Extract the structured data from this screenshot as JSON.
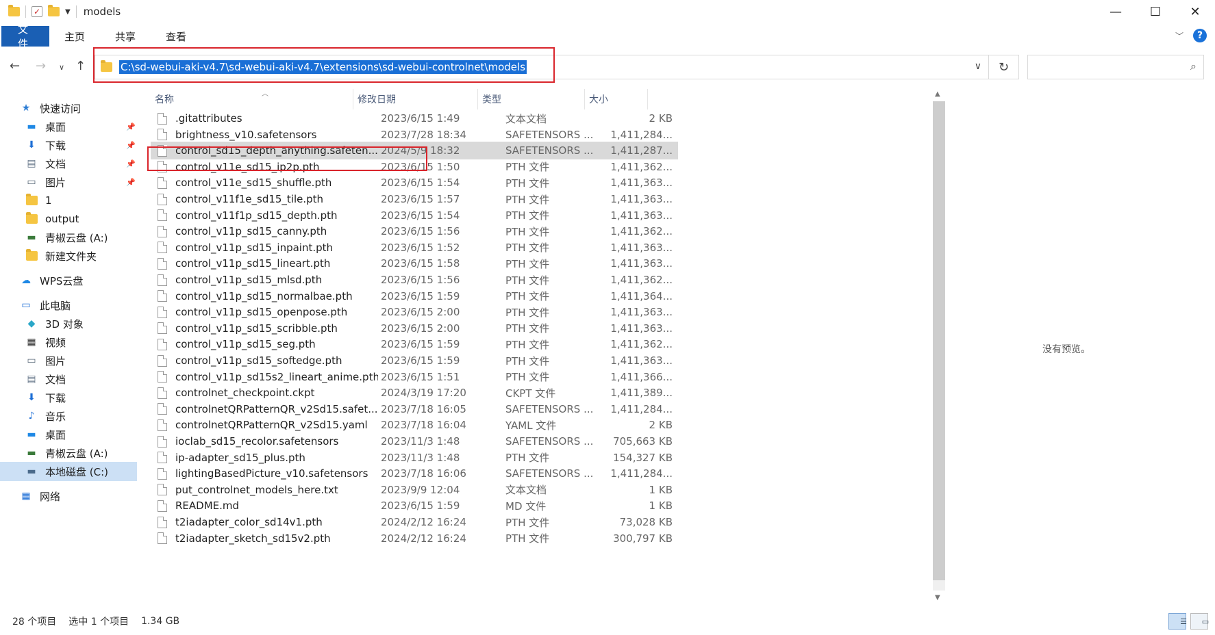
{
  "window": {
    "title": "models",
    "controls": {
      "minimize": "—",
      "maximize": "☐",
      "close": "✕"
    }
  },
  "ribbon": {
    "tabs": [
      "文件",
      "主页",
      "共享",
      "查看"
    ],
    "help": "?"
  },
  "address": {
    "path": "C:\\sd-webui-aki-v4.7\\sd-webui-aki-v4.7\\extensions\\sd-webui-controlnet\\models",
    "search_placeholder": ""
  },
  "sidebar": {
    "items": [
      {
        "label": "快速访问",
        "icon": "star-icon",
        "level": 0,
        "pinned": false
      },
      {
        "label": "桌面",
        "icon": "desktop-icon",
        "level": 1,
        "pinned": true
      },
      {
        "label": "下载",
        "icon": "download-icon",
        "level": 1,
        "pinned": true
      },
      {
        "label": "文档",
        "icon": "document-icon",
        "level": 1,
        "pinned": true
      },
      {
        "label": "图片",
        "icon": "pictures-icon",
        "level": 1,
        "pinned": true
      },
      {
        "label": "1",
        "icon": "folder-icon",
        "level": 1,
        "pinned": false
      },
      {
        "label": "output",
        "icon": "folder-icon",
        "level": 1,
        "pinned": false
      },
      {
        "label": "青椒云盘 (A:)",
        "icon": "network-drive-icon",
        "level": 1,
        "pinned": false
      },
      {
        "label": "新建文件夹",
        "icon": "folder-icon",
        "level": 1,
        "pinned": false
      },
      {
        "label": "WPS云盘",
        "icon": "cloud-icon",
        "level": 0,
        "pinned": false
      },
      {
        "label": "此电脑",
        "icon": "computer-icon",
        "level": 0,
        "pinned": false
      },
      {
        "label": "3D 对象",
        "icon": "3d-objects-icon",
        "level": 1,
        "pinned": false
      },
      {
        "label": "视频",
        "icon": "video-icon",
        "level": 1,
        "pinned": false
      },
      {
        "label": "图片",
        "icon": "pictures-icon",
        "level": 1,
        "pinned": false
      },
      {
        "label": "文档",
        "icon": "document-icon",
        "level": 1,
        "pinned": false
      },
      {
        "label": "下载",
        "icon": "download-icon",
        "level": 1,
        "pinned": false
      },
      {
        "label": "音乐",
        "icon": "music-icon",
        "level": 1,
        "pinned": false
      },
      {
        "label": "桌面",
        "icon": "desktop-icon",
        "level": 1,
        "pinned": false
      },
      {
        "label": "青椒云盘 (A:)",
        "icon": "network-drive-icon",
        "level": 1,
        "pinned": false
      },
      {
        "label": "本地磁盘 (C:)",
        "icon": "local-disk-icon",
        "level": 1,
        "pinned": false
      },
      {
        "label": "网络",
        "icon": "network-icon",
        "level": 0,
        "pinned": false
      }
    ],
    "selected_index": 19
  },
  "columns": [
    "名称",
    "修改日期",
    "类型",
    "大小"
  ],
  "files": [
    {
      "name": ".gitattributes",
      "date": "2023/6/15 1:49",
      "type": "文本文档",
      "size": "2 KB"
    },
    {
      "name": "brightness_v10.safetensors",
      "date": "2023/7/28 18:34",
      "type": "SAFETENSORS ...",
      "size": "1,411,284..."
    },
    {
      "name": "control_sd15_depth_anything.safeten...",
      "date": "2024/5/9 18:32",
      "type": "SAFETENSORS ...",
      "size": "1,411,287..."
    },
    {
      "name": "control_v11e_sd15_ip2p.pth",
      "date": "2023/6/15 1:50",
      "type": "PTH 文件",
      "size": "1,411,362..."
    },
    {
      "name": "control_v11e_sd15_shuffle.pth",
      "date": "2023/6/15 1:54",
      "type": "PTH 文件",
      "size": "1,411,363..."
    },
    {
      "name": "control_v11f1e_sd15_tile.pth",
      "date": "2023/6/15 1:57",
      "type": "PTH 文件",
      "size": "1,411,363..."
    },
    {
      "name": "control_v11f1p_sd15_depth.pth",
      "date": "2023/6/15 1:54",
      "type": "PTH 文件",
      "size": "1,411,363..."
    },
    {
      "name": "control_v11p_sd15_canny.pth",
      "date": "2023/6/15 1:56",
      "type": "PTH 文件",
      "size": "1,411,362..."
    },
    {
      "name": "control_v11p_sd15_inpaint.pth",
      "date": "2023/6/15 1:52",
      "type": "PTH 文件",
      "size": "1,411,363..."
    },
    {
      "name": "control_v11p_sd15_lineart.pth",
      "date": "2023/6/15 1:58",
      "type": "PTH 文件",
      "size": "1,411,363..."
    },
    {
      "name": "control_v11p_sd15_mlsd.pth",
      "date": "2023/6/15 1:56",
      "type": "PTH 文件",
      "size": "1,411,362..."
    },
    {
      "name": "control_v11p_sd15_normalbae.pth",
      "date": "2023/6/15 1:59",
      "type": "PTH 文件",
      "size": "1,411,364..."
    },
    {
      "name": "control_v11p_sd15_openpose.pth",
      "date": "2023/6/15 2:00",
      "type": "PTH 文件",
      "size": "1,411,363..."
    },
    {
      "name": "control_v11p_sd15_scribble.pth",
      "date": "2023/6/15 2:00",
      "type": "PTH 文件",
      "size": "1,411,363..."
    },
    {
      "name": "control_v11p_sd15_seg.pth",
      "date": "2023/6/15 1:59",
      "type": "PTH 文件",
      "size": "1,411,362..."
    },
    {
      "name": "control_v11p_sd15_softedge.pth",
      "date": "2023/6/15 1:59",
      "type": "PTH 文件",
      "size": "1,411,363..."
    },
    {
      "name": "control_v11p_sd15s2_lineart_anime.pth",
      "date": "2023/6/15 1:51",
      "type": "PTH 文件",
      "size": "1,411,366..."
    },
    {
      "name": "controlnet_checkpoint.ckpt",
      "date": "2024/3/19 17:20",
      "type": "CKPT 文件",
      "size": "1,411,389..."
    },
    {
      "name": "controlnetQRPatternQR_v2Sd15.safet...",
      "date": "2023/7/18 16:05",
      "type": "SAFETENSORS ...",
      "size": "1,411,284..."
    },
    {
      "name": "controlnetQRPatternQR_v2Sd15.yaml",
      "date": "2023/7/18 16:04",
      "type": "YAML 文件",
      "size": "2 KB"
    },
    {
      "name": "ioclab_sd15_recolor.safetensors",
      "date": "2023/11/3 1:48",
      "type": "SAFETENSORS ...",
      "size": "705,663 KB"
    },
    {
      "name": "ip-adapter_sd15_plus.pth",
      "date": "2023/11/3 1:48",
      "type": "PTH 文件",
      "size": "154,327 KB"
    },
    {
      "name": "lightingBasedPicture_v10.safetensors",
      "date": "2023/7/18 16:06",
      "type": "SAFETENSORS ...",
      "size": "1,411,284..."
    },
    {
      "name": "put_controlnet_models_here.txt",
      "date": "2023/9/9 12:04",
      "type": "文本文档",
      "size": "1 KB"
    },
    {
      "name": "README.md",
      "date": "2023/6/15 1:59",
      "type": "MD 文件",
      "size": "1 KB"
    },
    {
      "name": "t2iadapter_color_sd14v1.pth",
      "date": "2024/2/12 16:24",
      "type": "PTH 文件",
      "size": "73,028 KB"
    },
    {
      "name": "t2iadapter_sketch_sd15v2.pth",
      "date": "2024/2/12 16:24",
      "type": "PTH 文件",
      "size": "300,797 KB"
    }
  ],
  "selected_file_index": 2,
  "preview": {
    "text": "没有预览。"
  },
  "status": {
    "count": "28 个项目",
    "selection": "选中 1 个项目",
    "size": "1.34 GB"
  },
  "colors": {
    "accent": "#1a5fb4",
    "selection": "#1a6fd6",
    "highlight_box": "#d9242b"
  }
}
